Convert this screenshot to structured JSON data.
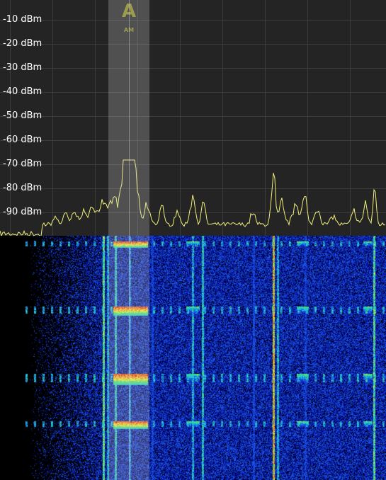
{
  "spectrum": {
    "db_labels": [
      "-10 dBm",
      "-20 dBm",
      "-30 dBm",
      "-40 dBm",
      "-50 dBm",
      "-60 dBm",
      "-70 dBm",
      "-80 dBm",
      "-90 dBm"
    ],
    "trace_color": "#f2f07a",
    "background_color": "#242424",
    "grid_color": "#3c3c3c"
  },
  "marker": {
    "letter": "A",
    "mode": "AM",
    "color": "#8a8a1e"
  },
  "waterfall": {
    "palette": [
      "#000010",
      "#00005a",
      "#0a1fb0",
      "#1a55e0",
      "#19c2d8",
      "#3fe07a",
      "#e8e82a",
      "#f08a1a",
      "#e02a12"
    ]
  }
}
